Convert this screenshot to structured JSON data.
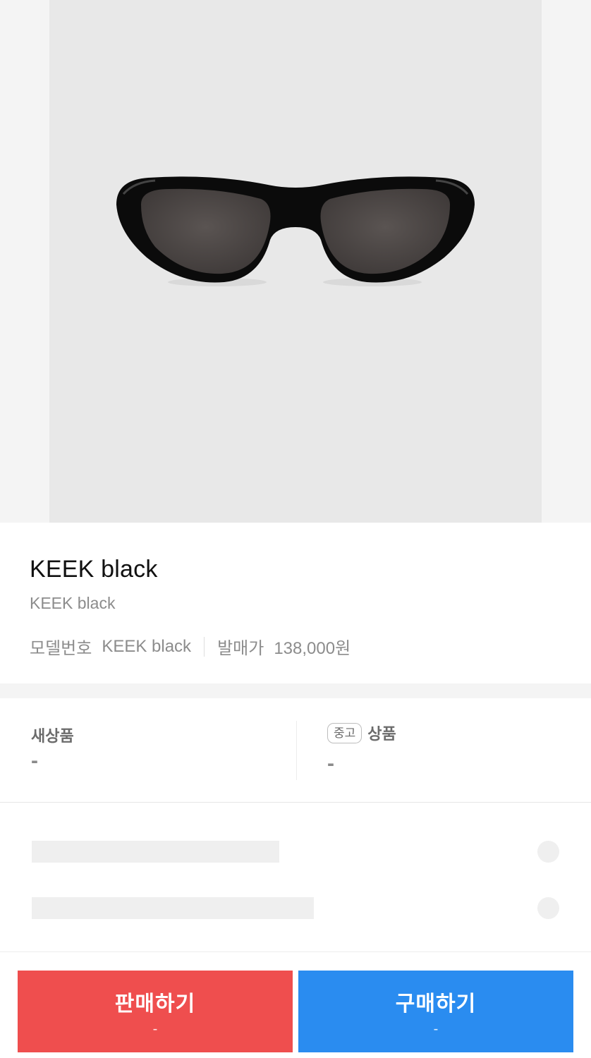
{
  "product": {
    "image_alt_icon": "sunglasses-icon",
    "title": "KEEK black",
    "subtitle": "KEEK black",
    "model_label": "모델번호",
    "model_value": "KEEK black",
    "release_label": "발매가",
    "release_value": "138,000원"
  },
  "prices": {
    "new": {
      "label": "새상품",
      "value": "-"
    },
    "used": {
      "tag": "중고",
      "label": "상품",
      "value": "-"
    }
  },
  "actions": {
    "sell": {
      "label": "판매하기",
      "price": "-",
      "color": "#ef4e4e"
    },
    "buy": {
      "label": "구매하기",
      "price": "-",
      "color": "#2a8cf0"
    }
  }
}
